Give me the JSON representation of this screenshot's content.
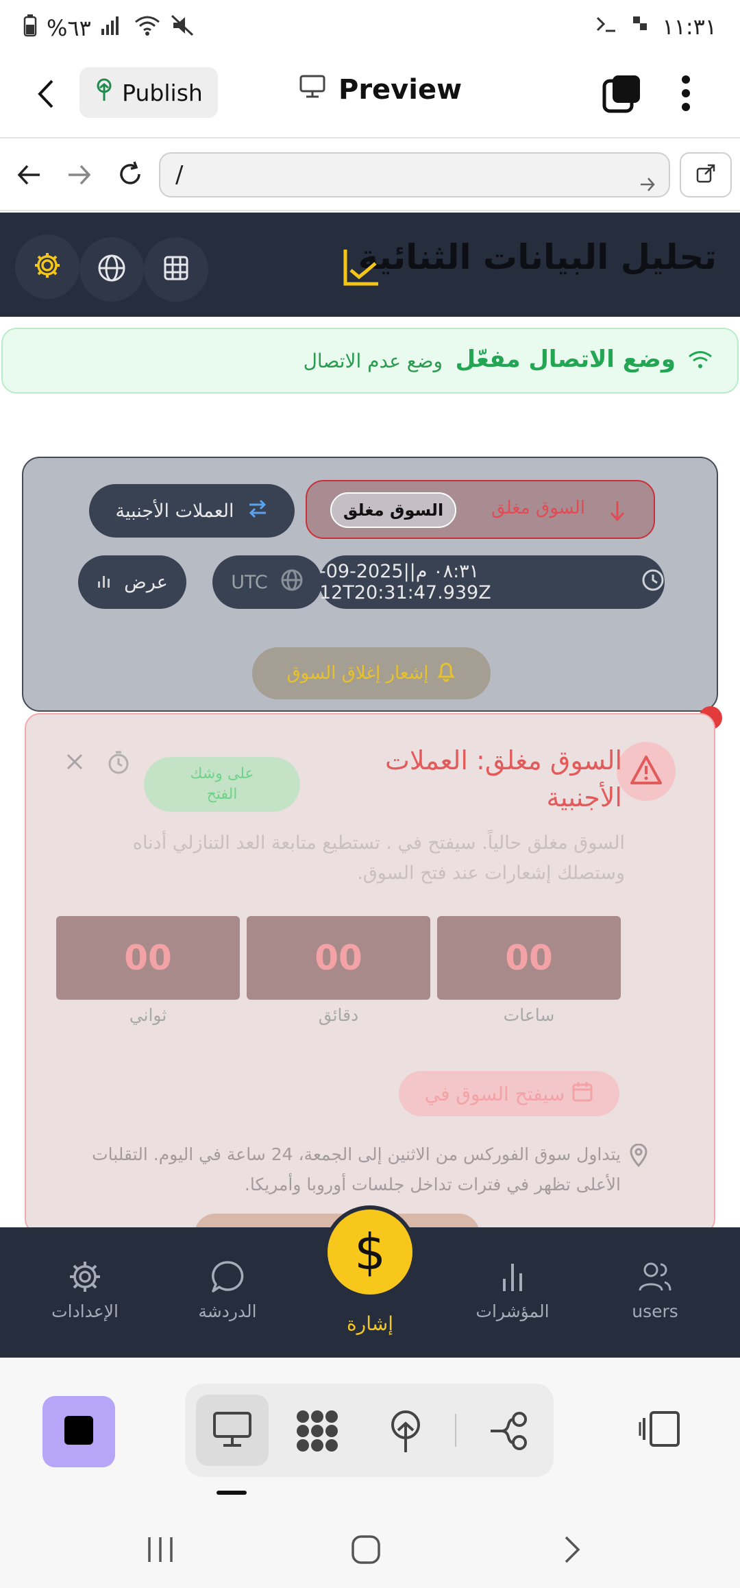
{
  "status_bar": {
    "battery": "%٦٣",
    "time": "١١:٣١"
  },
  "app_header": {
    "publish_label": "Publish",
    "preview_label": "Preview"
  },
  "url_bar": {
    "url": "/"
  },
  "page_header": {
    "title": "تحليل البيانات الثنائية"
  },
  "offline_banner": {
    "status": "وضع الاتصال مفعّل",
    "mode": "وضع عدم الاتصال"
  },
  "market_panel": {
    "market_closed_text": "السوق مغلق",
    "market_closed_pill": "السوق مغلق",
    "forex_chip": "العملات الأجنبية",
    "datetime": "٠٨:٣١ م||2025-09-12T20:31:47.939Z",
    "timezone": "UTC",
    "view_chip": "عرض",
    "notify_button": "إشعار إغلاق السوق"
  },
  "alert": {
    "title": "السوق مغلق: العملات الأجنبية",
    "badge": "على وشك الفتح",
    "description": "السوق مغلق حالياً. سيفتح في . تستطيع متابعة العد التنازلي أدناه وستصلك إشعارات عند فتح السوق.",
    "hours_value": "00",
    "hours_label": "ساعات",
    "minutes_value": "00",
    "minutes_label": "دقائق",
    "seconds_value": "00",
    "seconds_label": "ثواني",
    "opens_button": "سيفتح السوق في",
    "info": "يتداول سوق الفوركس من الاثنين إلى الجمعة، 24 ساعة في اليوم. التقلبات الأعلى تظهر في فترات تداخل جلسات أوروبا وأمريكا."
  },
  "bottom_nav": {
    "users": "users",
    "indicators": "المؤشرات",
    "signal": "إشارة",
    "chat": "الدردشة",
    "settings": "الإعدادات"
  },
  "colors": {
    "dark_header": "#262d3d",
    "accent_yellow": "#f7c81b",
    "green": "#22a653",
    "alert_red": "#e35a5a"
  }
}
